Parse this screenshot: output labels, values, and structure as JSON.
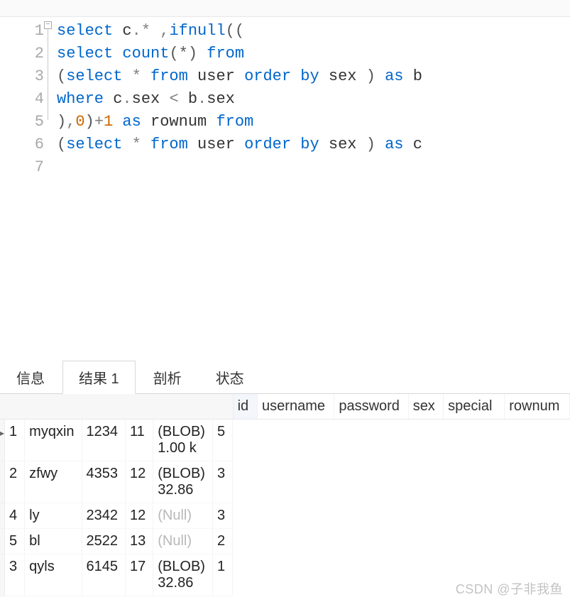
{
  "editor": {
    "lines": [
      [
        {
          "t": "select",
          "c": "kw"
        },
        {
          "t": " c",
          "c": "id"
        },
        {
          "t": ".*",
          "c": "op"
        },
        {
          "t": " ",
          "c": "id"
        },
        {
          "t": ",",
          "c": "op"
        },
        {
          "t": "ifnull",
          "c": "fn"
        },
        {
          "t": "((",
          "c": "par"
        }
      ],
      [
        {
          "t": "select",
          "c": "kw"
        },
        {
          "t": " ",
          "c": "id"
        },
        {
          "t": "count",
          "c": "fn"
        },
        {
          "t": "(*)",
          "c": "par"
        },
        {
          "t": " ",
          "c": "id"
        },
        {
          "t": "from",
          "c": "kw"
        }
      ],
      [
        {
          "t": "(",
          "c": "par"
        },
        {
          "t": "select",
          "c": "kw"
        },
        {
          "t": " ",
          "c": "id"
        },
        {
          "t": "*",
          "c": "op"
        },
        {
          "t": " ",
          "c": "id"
        },
        {
          "t": "from",
          "c": "kw"
        },
        {
          "t": " user ",
          "c": "id"
        },
        {
          "t": "order by",
          "c": "kw"
        },
        {
          "t": " sex ",
          "c": "id"
        },
        {
          "t": ")",
          "c": "par"
        },
        {
          "t": " ",
          "c": "id"
        },
        {
          "t": "as",
          "c": "kw"
        },
        {
          "t": " b",
          "c": "id"
        }
      ],
      [
        {
          "t": "where",
          "c": "kw"
        },
        {
          "t": " c",
          "c": "id"
        },
        {
          "t": ".",
          "c": "op"
        },
        {
          "t": "sex ",
          "c": "id"
        },
        {
          "t": "<",
          "c": "op"
        },
        {
          "t": " b",
          "c": "id"
        },
        {
          "t": ".",
          "c": "op"
        },
        {
          "t": "sex",
          "c": "id"
        }
      ],
      [
        {
          "t": ")",
          "c": "par"
        },
        {
          "t": ",",
          "c": "op"
        },
        {
          "t": "0",
          "c": "num"
        },
        {
          "t": ")",
          "c": "par"
        },
        {
          "t": "+",
          "c": "op"
        },
        {
          "t": "1",
          "c": "num"
        },
        {
          "t": " ",
          "c": "id"
        },
        {
          "t": "as",
          "c": "kw"
        },
        {
          "t": " rownum ",
          "c": "id"
        },
        {
          "t": "from",
          "c": "kw"
        }
      ],
      [
        {
          "t": "(",
          "c": "par"
        },
        {
          "t": "select",
          "c": "kw"
        },
        {
          "t": " ",
          "c": "id"
        },
        {
          "t": "*",
          "c": "op"
        },
        {
          "t": " ",
          "c": "id"
        },
        {
          "t": "from",
          "c": "kw"
        },
        {
          "t": " user ",
          "c": "id"
        },
        {
          "t": "order by",
          "c": "kw"
        },
        {
          "t": " sex ",
          "c": "id"
        },
        {
          "t": ")",
          "c": "par"
        },
        {
          "t": " ",
          "c": "id"
        },
        {
          "t": "as",
          "c": "kw"
        },
        {
          "t": " c",
          "c": "id"
        }
      ],
      []
    ],
    "line_numbers": [
      "1",
      "2",
      "3",
      "4",
      "5",
      "6",
      "7"
    ],
    "fold_glyph": "−"
  },
  "tabs": {
    "items": [
      "信息",
      "结果 1",
      "剖析",
      "状态"
    ],
    "active_index": 1
  },
  "result": {
    "columns": [
      "id",
      "username",
      "password",
      "sex",
      "special",
      "rownum"
    ],
    "rows": [
      {
        "id": "1",
        "username": "myqxin",
        "password": "1234",
        "sex": "11",
        "special": "(BLOB) 1.00 k",
        "rownum": "5",
        "null_special": false,
        "current": true
      },
      {
        "id": "2",
        "username": "zfwy",
        "password": "4353",
        "sex": "12",
        "special": "(BLOB) 32.86",
        "rownum": "3",
        "null_special": false,
        "current": false
      },
      {
        "id": "4",
        "username": "ly",
        "password": "2342",
        "sex": "12",
        "special": "(Null)",
        "rownum": "3",
        "null_special": true,
        "current": false
      },
      {
        "id": "5",
        "username": "bl",
        "password": "2522",
        "sex": "13",
        "special": "(Null)",
        "rownum": "2",
        "null_special": true,
        "current": false
      },
      {
        "id": "3",
        "username": "qyls",
        "password": "6145",
        "sex": "17",
        "special": "(BLOB) 32.86",
        "rownum": "1",
        "null_special": false,
        "current": false
      }
    ]
  },
  "watermark": "CSDN @子非我鱼"
}
